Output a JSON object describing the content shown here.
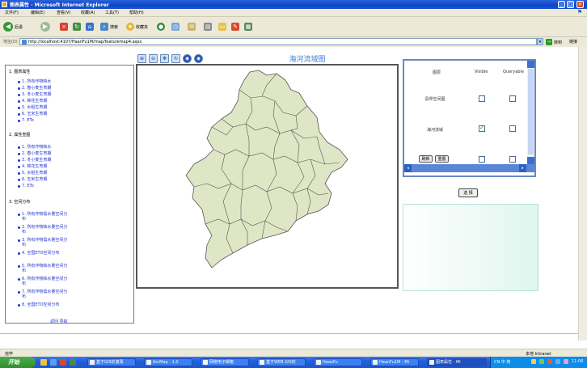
{
  "window": {
    "title": "图表属性 - Microsoft Internet Explorer",
    "minimize": "_",
    "maximize": "□",
    "close": "×"
  },
  "menu": [
    "文件(F)",
    "编辑(E)",
    "查看(V)",
    "收藏(A)",
    "工具(T)",
    "帮助(H)"
  ],
  "toolbar": {
    "back_label": "后退",
    "search_label": "搜索",
    "favorites_label": "收藏夹"
  },
  "address": {
    "label": "地址(D)",
    "url": "http://localhost:4107/HaanFu1M/map/featuremap4.aspx",
    "go_label": "转到",
    "links_label": "链接"
  },
  "sidebar": {
    "sections": [
      {
        "heading": "1. 图表属性",
        "items": [
          "1. 所有作物缺水",
          "2. 春小麦生育期",
          "3. 冬小麦生育期",
          "4. 棉花生育期",
          "5. 水稻生育期",
          "6. 玉米生育期",
          "7. ETo"
        ]
      },
      {
        "heading": "2. 属性查图",
        "items": [
          "1. 所有作物缺水",
          "2. 春小麦生育期",
          "3. 冬小麦生育期",
          "4. 棉花生育期",
          "5. 水稻生育期",
          "6. 玉米生育期",
          "7. ETo"
        ]
      },
      {
        "heading": "3. 空间分布",
        "items": [
          "1. 所有作物需水量空间分布",
          "2. 所有作物缺水量空间分布",
          "3. 所有作物需水量空间分布",
          "4. 全国ETO空间分布",
          "5. 所有作物缺水量空间分布",
          "6. 所有作物缺水量空间分布",
          "7. 所有作物需水量空间分布",
          "8. 全国ETO空间分布"
        ]
      }
    ],
    "footer": "返回 导航"
  },
  "map": {
    "title": "海河流域图",
    "tools": [
      "zoom-in-icon",
      "zoom-out-icon",
      "pan-icon",
      "refresh-icon",
      "full-extent-icon",
      "identify-icon"
    ],
    "fill_color": "#dfe6c6",
    "stroke_color": "#555555"
  },
  "layers_panel": {
    "col_name": "图层",
    "col_visible": "Visible",
    "col_queryable": "Queryable",
    "rows": [
      {
        "name": "县界空间图",
        "visible": false,
        "queryable": false
      },
      {
        "name": "海河流域",
        "visible": true,
        "queryable": false
      },
      {
        "name": "",
        "visible": false,
        "queryable": false
      }
    ],
    "refresh_btn": "刷新",
    "reset_btn": "重置"
  },
  "select_button": "选 择",
  "status": {
    "left": "完毕",
    "right": "本地 Intranet"
  },
  "taskbar": {
    "start": "开始",
    "tasks": [
      "基于GIS的灌溉",
      "ArcMap - 1.0",
      "网络电子邮箱",
      "基于WEB GIS的",
      "HaanFu",
      "HaanFu1M - Mi",
      "图表属性 - Mi"
    ],
    "tray_text": "CN 中 简",
    "clock": "11:06"
  }
}
